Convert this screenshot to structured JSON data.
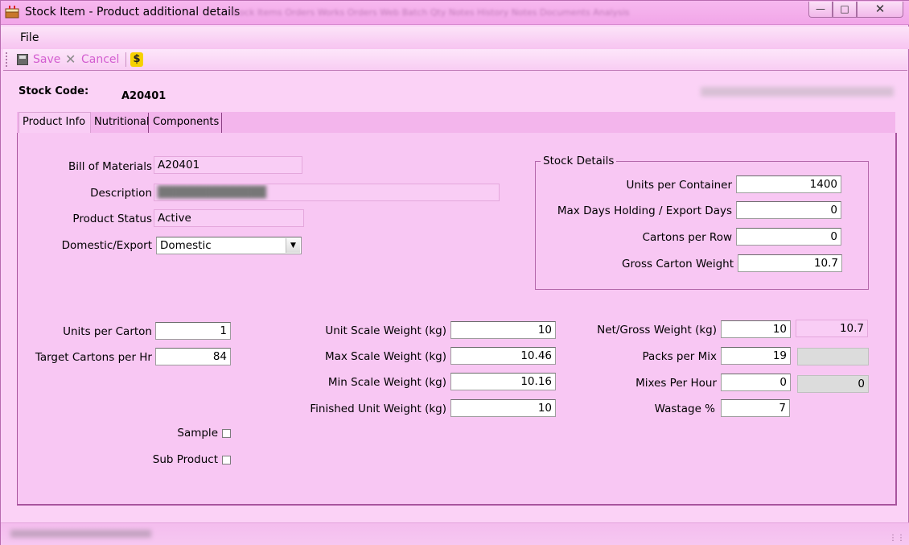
{
  "window": {
    "title": "Stock Item - Product additional details",
    "background_tabs": "Stock Items   Orders   Works Orders   Web   Batch Qty   Notes   History Notes   Documents   Analysis"
  },
  "menu": {
    "file": "File"
  },
  "toolbar": {
    "save": "Save",
    "cancel": "Cancel",
    "dollar": "$"
  },
  "header": {
    "stock_code_label": "Stock Code:",
    "stock_code_value": "A20401"
  },
  "tabs": [
    "Product Info",
    "Nutritional",
    "Components"
  ],
  "product": {
    "bom_label": "Bill of Materials",
    "bom_value": "A20401",
    "description_label": "Description",
    "status_label": "Product Status",
    "status_value": "Active",
    "domestic_label": "Domestic/Export",
    "domestic_value": "Domestic"
  },
  "stock_details": {
    "title": "Stock Details",
    "units_per_container_label": "Units per Container",
    "units_per_container": "1400",
    "max_days_label": "Max Days Holding / Export Days",
    "max_days": "0",
    "cartons_per_row_label": "Cartons per Row",
    "cartons_per_row": "0",
    "gross_carton_weight_label": "Gross Carton Weight",
    "gross_carton_weight": "10.7"
  },
  "col1": {
    "units_per_carton_label": "Units per Carton",
    "units_per_carton": "1",
    "target_cartons_label": "Target Cartons per Hr",
    "target_cartons": "84",
    "sample_label": "Sample",
    "sub_product_label": "Sub Product"
  },
  "col2": {
    "unit_scale_label": "Unit Scale Weight (kg)",
    "unit_scale": "10",
    "max_scale_label": "Max Scale Weight (kg)",
    "max_scale": "10.46",
    "min_scale_label": "Min Scale Weight (kg)",
    "min_scale": "10.16",
    "finished_label": "Finished Unit Weight (kg)",
    "finished": "10"
  },
  "col3": {
    "net_gross_label": "Net/Gross Weight (kg)",
    "net": "10",
    "gross": "10.7",
    "packs_per_mix_label": "Packs per Mix",
    "packs_per_mix": "19",
    "mixes_per_hour_label": "Mixes Per Hour",
    "mixes_per_hour": "0",
    "mixes_per_hour_calc": "0",
    "wastage_label": "Wastage %",
    "wastage": "7"
  }
}
